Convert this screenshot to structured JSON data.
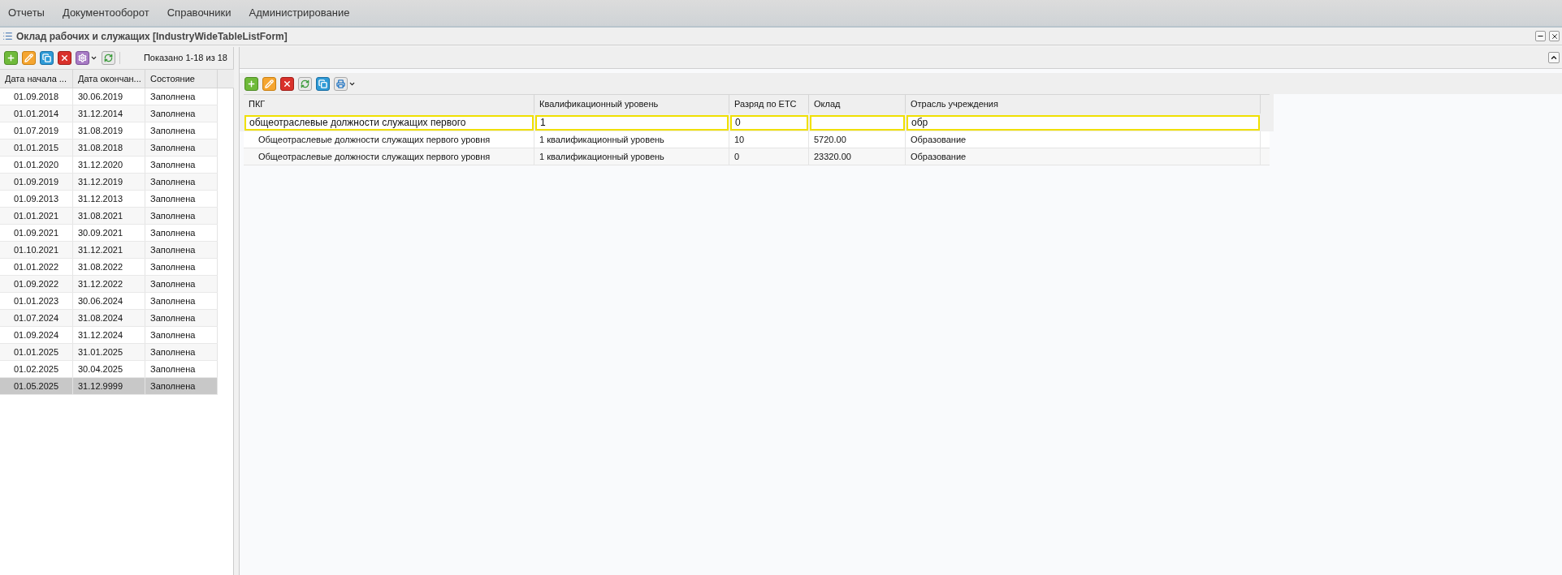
{
  "menu": [
    "Отчеты",
    "Документооборот",
    "Справочники",
    "Администрирование"
  ],
  "window": {
    "title": "Оклад рабочих и служащих [IndustryWideTableListForm]"
  },
  "left": {
    "paging": "Показано 1-18 из 18",
    "columns": [
      "Дата начала ...",
      "Дата окончан...",
      "Состояние"
    ],
    "rows": [
      {
        "cells": [
          "01.09.2018",
          "30.06.2019",
          "Заполнена"
        ],
        "selected": false
      },
      {
        "cells": [
          "01.01.2014",
          "31.12.2014",
          "Заполнена"
        ],
        "selected": false
      },
      {
        "cells": [
          "01.07.2019",
          "31.08.2019",
          "Заполнена"
        ],
        "selected": false
      },
      {
        "cells": [
          "01.01.2015",
          "31.08.2018",
          "Заполнена"
        ],
        "selected": false
      },
      {
        "cells": [
          "01.01.2020",
          "31.12.2020",
          "Заполнена"
        ],
        "selected": false
      },
      {
        "cells": [
          "01.09.2019",
          "31.12.2019",
          "Заполнена"
        ],
        "selected": false
      },
      {
        "cells": [
          "01.09.2013",
          "31.12.2013",
          "Заполнена"
        ],
        "selected": false
      },
      {
        "cells": [
          "01.01.2021",
          "31.08.2021",
          "Заполнена"
        ],
        "selected": false
      },
      {
        "cells": [
          "01.09.2021",
          "30.09.2021",
          "Заполнена"
        ],
        "selected": false
      },
      {
        "cells": [
          "01.10.2021",
          "31.12.2021",
          "Заполнена"
        ],
        "selected": false
      },
      {
        "cells": [
          "01.01.2022",
          "31.08.2022",
          "Заполнена"
        ],
        "selected": false
      },
      {
        "cells": [
          "01.09.2022",
          "31.12.2022",
          "Заполнена"
        ],
        "selected": false
      },
      {
        "cells": [
          "01.01.2023",
          "30.06.2024",
          "Заполнена"
        ],
        "selected": false
      },
      {
        "cells": [
          "01.07.2024",
          "31.08.2024",
          "Заполнена"
        ],
        "selected": false
      },
      {
        "cells": [
          "01.09.2024",
          "31.12.2024",
          "Заполнена"
        ],
        "selected": false
      },
      {
        "cells": [
          "01.01.2025",
          "31.01.2025",
          "Заполнена"
        ],
        "selected": false
      },
      {
        "cells": [
          "01.02.2025",
          "30.04.2025",
          "Заполнена"
        ],
        "selected": false
      },
      {
        "cells": [
          "01.05.2025",
          "31.12.9999",
          "Заполнена"
        ],
        "selected": true
      }
    ]
  },
  "right": {
    "columns": [
      {
        "label": "ПКГ",
        "filter": "общеотраслевые должности служащих первого"
      },
      {
        "label": "Квалификационный уровень",
        "filter": "1"
      },
      {
        "label": "Разряд по ЕТС",
        "filter": "0"
      },
      {
        "label": "Оклад"
      },
      {
        "label": "Отрасль учреждения",
        "filter": "обр"
      }
    ],
    "rows": [
      [
        "Общеотраслевые должности служащих первого уровня",
        "1 квалификационный уровень",
        "10",
        "5720.00",
        "Образование"
      ],
      [
        "Общеотраслевые должности служащих первого уровня",
        "1 квалификационный уровень",
        "0",
        "23320.00",
        "Образование"
      ]
    ]
  }
}
